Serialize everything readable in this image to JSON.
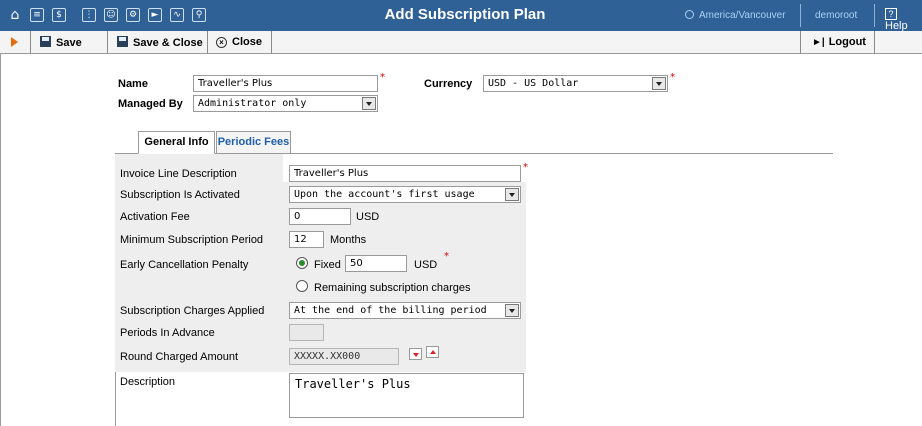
{
  "topbar": {
    "title": "Add Subscription Plan",
    "timezone": "America/Vancouver",
    "user": "demoroot",
    "help": "Help",
    "icons": [
      "home-icon",
      "list-icon",
      "dollar-icon",
      "grid-icon",
      "person-icon",
      "config-icon",
      "export-icon",
      "chart-icon",
      "search-icon"
    ]
  },
  "toolbar": {
    "save": "Save",
    "save_close": "Save & Close",
    "close": "Close",
    "logout": "Logout"
  },
  "form": {
    "name_label": "Name",
    "name_value": "Traveller's Plus",
    "managed_by_label": "Managed By",
    "managed_by_value": "Administrator only",
    "currency_label": "Currency",
    "currency_value": "USD - US Dollar"
  },
  "tabs": [
    {
      "label": "General Info",
      "active": true
    },
    {
      "label": "Periodic Fees",
      "active": false
    }
  ],
  "general": {
    "invoice_line_label": "Invoice Line Description",
    "invoice_line_value": "Traveller's Plus",
    "activated_label": "Subscription Is Activated",
    "activated_value": "Upon the account's first usage",
    "activation_fee_label": "Activation Fee",
    "activation_fee_value": "0",
    "activation_fee_unit": "USD",
    "min_period_label": "Minimum Subscription Period",
    "min_period_value": "12",
    "min_period_unit": "Months",
    "penalty_label": "Early Cancellation Penalty",
    "penalty_fixed_label": "Fixed",
    "penalty_fixed_value": "50",
    "penalty_unit": "USD",
    "penalty_remaining_label": "Remaining subscription charges",
    "penalty_selected": "Fixed",
    "charges_applied_label": "Subscription Charges Applied",
    "charges_applied_value": "At the end of the billing period",
    "periods_advance_label": "Periods In Advance",
    "periods_advance_value": "",
    "round_label": "Round Charged Amount",
    "round_value": "XXXXX.XX000",
    "description_label": "Description",
    "description_value": "Traveller's Plus"
  },
  "colors": {
    "topbar_bg": "#2f6196",
    "accent_link": "#1f5fa8",
    "required": "#dd0000"
  }
}
